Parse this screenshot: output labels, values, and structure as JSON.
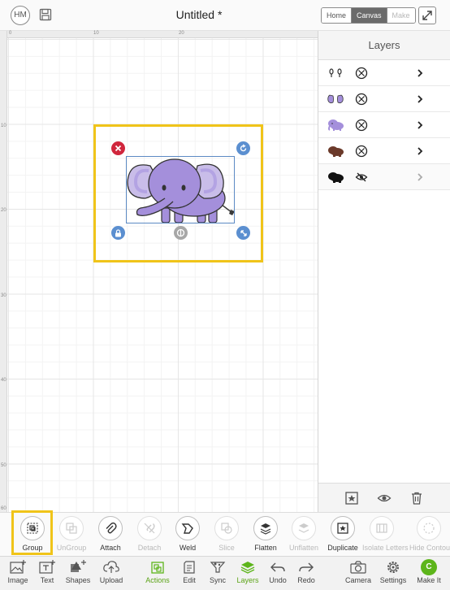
{
  "header": {
    "user_initials": "HM",
    "document_title": "Untitled *",
    "view_tabs": [
      {
        "label": "Home",
        "state": "normal"
      },
      {
        "label": "Canvas",
        "state": "active"
      },
      {
        "label": "Make",
        "state": "disabled"
      }
    ]
  },
  "rulers": {
    "top": [
      "0",
      "10",
      "20"
    ],
    "left": [
      "10",
      "20",
      "30",
      "40",
      "50",
      "60"
    ]
  },
  "layers_panel": {
    "title": "Layers",
    "layers": [
      {
        "thumb": "elephant-eyes",
        "visibility": "visible"
      },
      {
        "thumb": "elephant-ears",
        "visibility": "visible"
      },
      {
        "thumb": "elephant-body",
        "visibility": "visible"
      },
      {
        "thumb": "elephant-outline",
        "visibility": "visible"
      },
      {
        "thumb": "elephant-shadow",
        "visibility": "hidden"
      }
    ]
  },
  "actions": [
    {
      "label": "Group",
      "enabled": true
    },
    {
      "label": "UnGroup",
      "enabled": false
    },
    {
      "label": "Attach",
      "enabled": true
    },
    {
      "label": "Detach",
      "enabled": false
    },
    {
      "label": "Weld",
      "enabled": true
    },
    {
      "label": "Slice",
      "enabled": false
    },
    {
      "label": "Flatten",
      "enabled": true
    },
    {
      "label": "Unflatten",
      "enabled": false
    },
    {
      "label": "Duplicate",
      "enabled": true
    },
    {
      "label": "Isolate Letters",
      "enabled": false
    },
    {
      "label": "Hide Contour",
      "enabled": false
    }
  ],
  "nav": [
    {
      "label": "Image"
    },
    {
      "label": "Text"
    },
    {
      "label": "Shapes"
    },
    {
      "label": "Upload"
    },
    {
      "label": "Actions",
      "active": true
    },
    {
      "label": "Edit"
    },
    {
      "label": "Sync"
    },
    {
      "label": "Layers",
      "active": true
    },
    {
      "label": "Undo"
    },
    {
      "label": "Redo"
    },
    {
      "label": "Camera"
    },
    {
      "label": "Settings"
    },
    {
      "label": "Make It",
      "badge": "C"
    }
  ],
  "colors": {
    "accent_green": "#5db51b",
    "highlight_yellow": "#f0c419",
    "elephant_purple": "#a48fdb",
    "handle_blue": "#5b8fd0",
    "handle_red": "#d0263c"
  }
}
